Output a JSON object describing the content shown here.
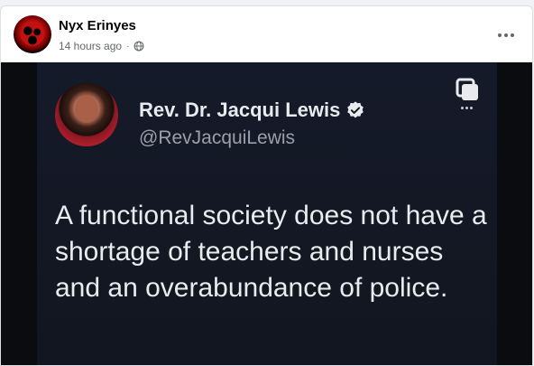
{
  "post": {
    "author": "Nyx Erinyes",
    "timestamp": "14 hours ago",
    "separator": "·",
    "privacy_icon": "globe-icon",
    "more_icon": "more-options-icon"
  },
  "tweet": {
    "name": "Rev. Dr. Jacqui Lewis",
    "handle": "@RevJacquiLewis",
    "text": "A functional society does not have a shortage of teachers and nurses and an overabundance of police.",
    "verified_icon": "verified-badge-icon",
    "copy_icon": "copy-icon"
  },
  "colors": {
    "tweet_bg": "#141824",
    "tweet_text": "#e9ebee",
    "handle": "#9aa0a8",
    "meta": "#65676b"
  }
}
